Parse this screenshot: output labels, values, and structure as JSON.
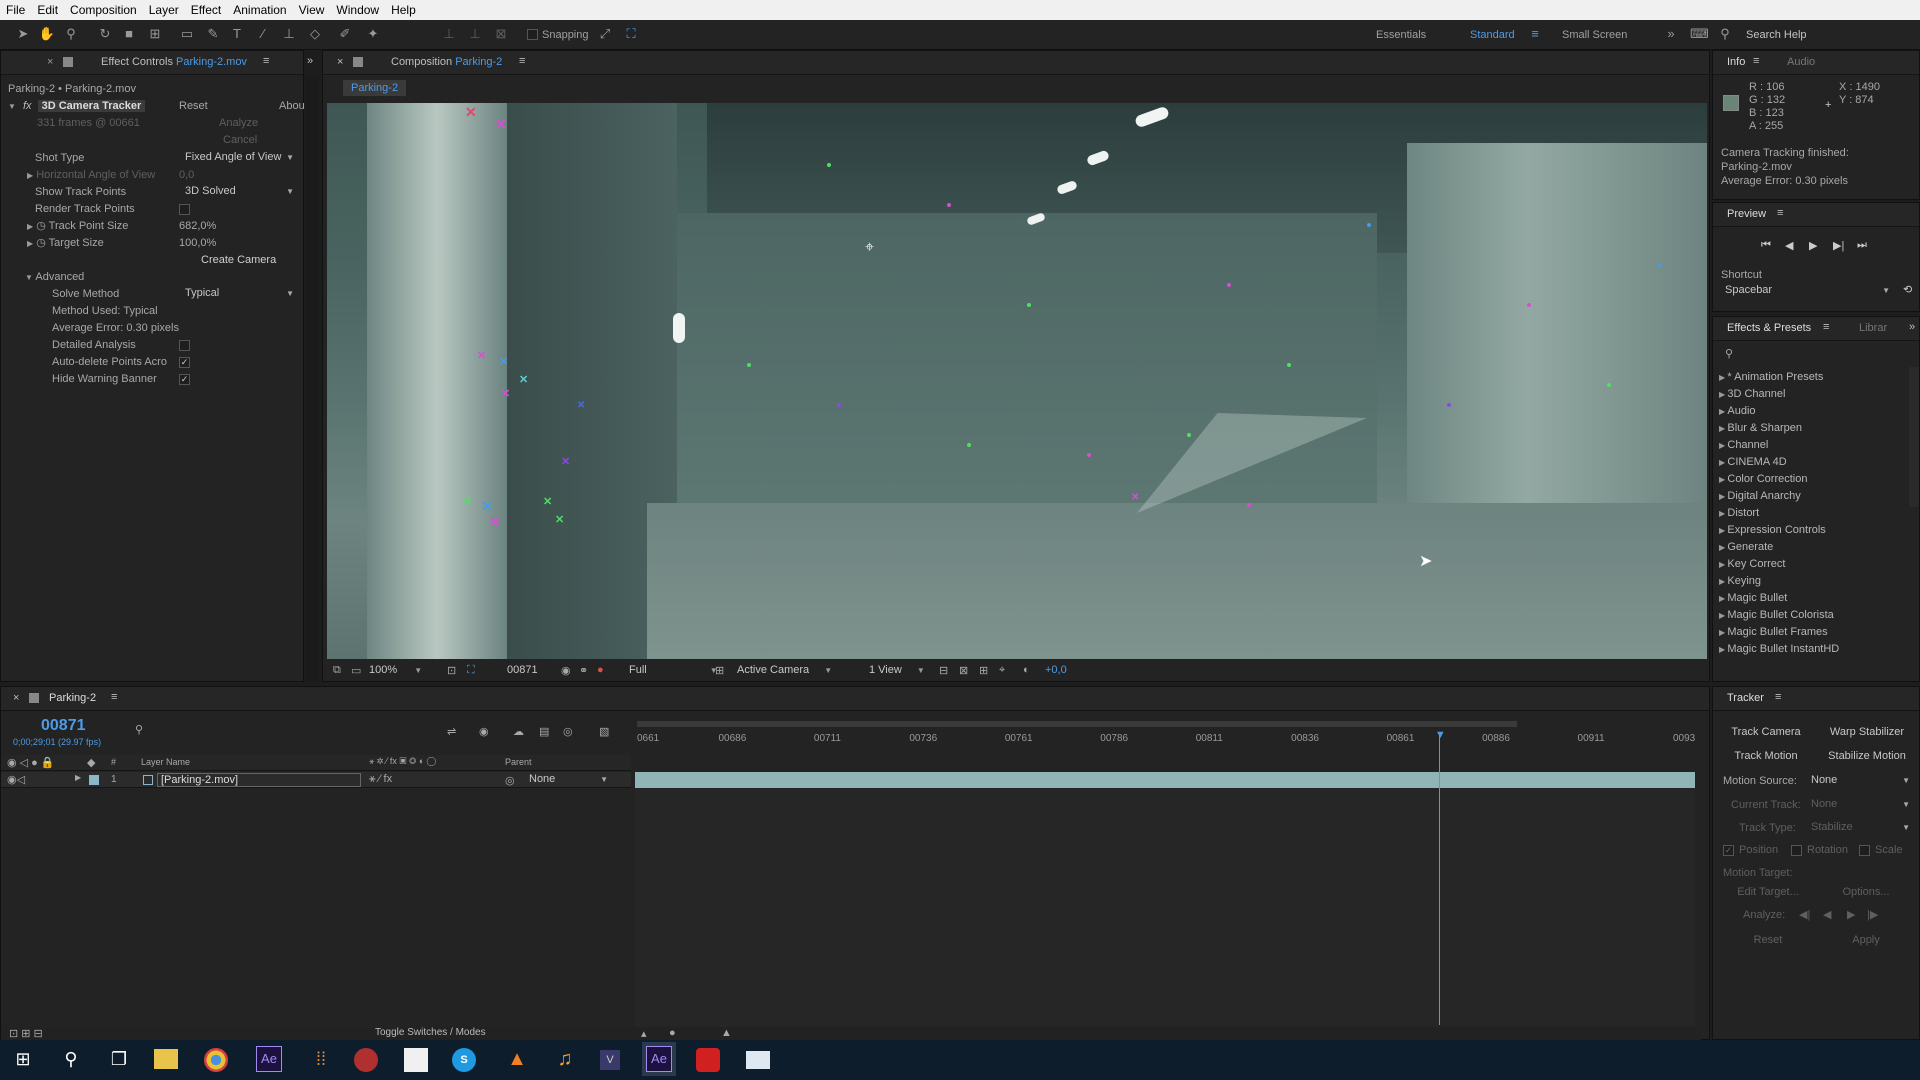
{
  "menu": [
    "File",
    "Edit",
    "Composition",
    "Layer",
    "Effect",
    "Animation",
    "View",
    "Window",
    "Help"
  ],
  "toolbar": {
    "snapping": "Snapping",
    "workspaces": [
      "Essentials",
      "Standard",
      "Small Screen"
    ],
    "active_workspace": "Standard",
    "search_help": "Search Help"
  },
  "effect_controls": {
    "tab_label": "Effect Controls",
    "tab_file": "Parking-2.mov",
    "breadcrumb": "Parking-2 • Parking-2.mov",
    "effect_name": "3D Camera Tracker",
    "reset": "Reset",
    "about": "Abou",
    "analyze": "Analyze",
    "frames_info": "331 frames @ 00661",
    "cancel": "Cancel",
    "shot_type_label": "Shot Type",
    "shot_type_value": "Fixed Angle of View",
    "h_angle_label": "Horizontal Angle of View",
    "h_angle_value": "0,0",
    "show_track_points_label": "Show Track Points",
    "show_track_points_value": "3D Solved",
    "render_track_points_label": "Render Track Points",
    "track_point_size_label": "Track Point Size",
    "track_point_size_value": "682,0%",
    "target_size_label": "Target Size",
    "target_size_value": "100,0%",
    "create_camera": "Create Camera",
    "advanced_label": "Advanced",
    "solve_method_label": "Solve Method",
    "solve_method_value": "Typical",
    "method_used": "Method Used: Typical",
    "average_error": "Average Error: 0.30 pixels",
    "detailed_analysis": "Detailed Analysis",
    "auto_delete": "Auto-delete Points Acro",
    "hide_warning": "Hide Warning Banner"
  },
  "composition": {
    "tab_label": "Composition",
    "tab_name": "Parking-2",
    "comp_chip": "Parking-2",
    "zoom": "100%",
    "timecode": "00871",
    "resolution": "Full",
    "camera": "Active Camera",
    "views": "1 View",
    "exposure": "+0,0"
  },
  "info": {
    "tab": "Info",
    "tab2": "Audio",
    "r": "R : 106",
    "g": "G : 132",
    "b": "B : 123",
    "a": "A : 255",
    "x": "X : 1490",
    "y": "Y : 874",
    "message1": "Camera Tracking finished:",
    "message2": "Parking-2.mov",
    "message3": "Average Error: 0.30 pixels",
    "swatch_color": "#6a8478"
  },
  "preview": {
    "title": "Preview",
    "shortcut_label": "Shortcut",
    "shortcut_value": "Spacebar"
  },
  "effects_presets": {
    "tab": "Effects & Presets",
    "tab2": "Librar",
    "items": [
      "* Animation Presets",
      "3D Channel",
      "Audio",
      "Blur & Sharpen",
      "Channel",
      "CINEMA 4D",
      "Color Correction",
      "Digital Anarchy",
      "Distort",
      "Expression Controls",
      "Generate",
      "Key Correct",
      "Keying",
      "Magic Bullet",
      "Magic Bullet Colorista",
      "Magic Bullet Frames",
      "Magic Bullet InstantHD"
    ]
  },
  "timeline": {
    "tab": "Parking-2",
    "timecode": "00871",
    "timecode_sub": "0;00;29;01 (29.97 fps)",
    "col_layer_name": "Layer Name",
    "col_parent": "Parent",
    "col_hash": "#",
    "layer_number": "1",
    "layer_name": "[Parking-2.mov]",
    "layer_parent": "None",
    "ruler_ticks": [
      "0661",
      "00686",
      "00711",
      "00736",
      "00761",
      "00786",
      "00811",
      "00836",
      "00861",
      "00886",
      "00911",
      "0093"
    ],
    "playhead_frame": 871,
    "toggle_label": "Toggle Switches / Modes"
  },
  "tracker": {
    "title": "Tracker",
    "track_camera": "Track Camera",
    "warp_stabilizer": "Warp Stabilizer",
    "track_motion": "Track Motion",
    "stabilize_motion": "Stabilize Motion",
    "motion_source_label": "Motion Source:",
    "motion_source_value": "None",
    "current_track_label": "Current Track:",
    "current_track_value": "None",
    "track_type_label": "Track Type:",
    "track_type_value": "Stabilize",
    "position": "Position",
    "rotation": "Rotation",
    "scale": "Scale",
    "motion_target": "Motion Target:",
    "edit_target": "Edit Target...",
    "options": "Options...",
    "analyze": "Analyze:",
    "reset": "Reset",
    "apply": "Apply"
  }
}
